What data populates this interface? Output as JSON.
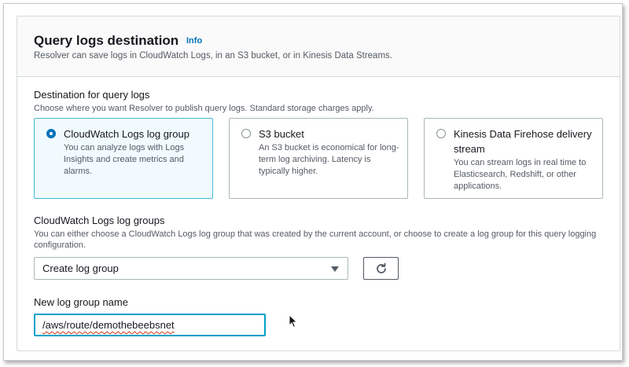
{
  "panel": {
    "title": "Query logs destination",
    "info_link": "Info",
    "subtitle": "Resolver can save logs in CloudWatch Logs, in an S3 bucket, or in Kinesis Data Streams."
  },
  "destination": {
    "label": "Destination for query logs",
    "description": "Choose where you want Resolver to publish query logs. Standard storage charges apply.",
    "options": [
      {
        "title": "CloudWatch Logs log group",
        "description": "You can analyze logs with Logs Insights and create metrics and alarms.",
        "selected": true
      },
      {
        "title": "S3 bucket",
        "description": "An S3 bucket is economical for long-term log archiving. Latency is typically higher.",
        "selected": false
      },
      {
        "title": "Kinesis Data Firehose delivery stream",
        "description": "You can stream logs in real time to Elasticsearch, Redshift, or other applications.",
        "selected": false
      }
    ]
  },
  "log_groups": {
    "label": "CloudWatch Logs log groups",
    "description": "You can either choose a CloudWatch Logs log group that was created by the current account, or choose to create a log group for this query logging configuration.",
    "selected_value": "Create log group",
    "refresh_icon": "refresh-icon"
  },
  "new_log_group": {
    "label": "New log group name",
    "value": "/aws/route/demothebeebsnet"
  },
  "colors": {
    "accent": "#0073bb",
    "selected_border": "#44b9d6",
    "selected_bg": "#f1faff",
    "focus_border": "#00a1c9"
  }
}
